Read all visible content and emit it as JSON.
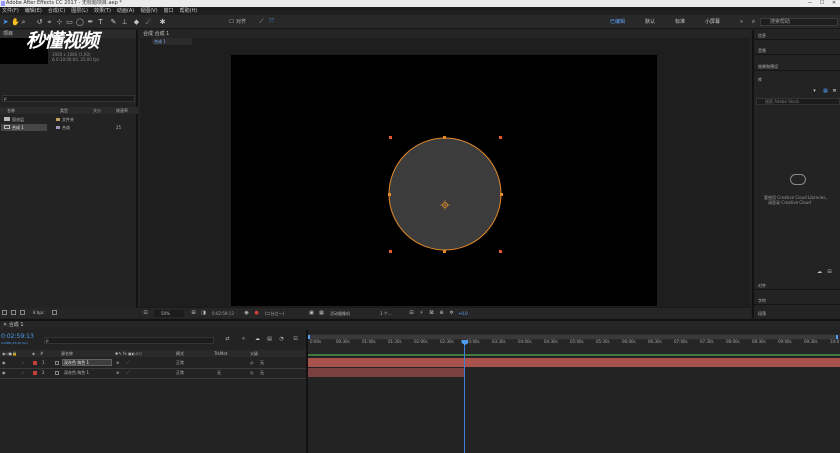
{
  "window": {
    "title": "Adobe After Effects CC 2017 - 无标题项目.aep *",
    "min": "—",
    "max": "☐",
    "close": "✕"
  },
  "menu": [
    "文件(F)",
    "编辑(E)",
    "合成(C)",
    "图层(L)",
    "效果(T)",
    "动画(A)",
    "视图(V)",
    "窗口",
    "帮助(H)"
  ],
  "toolbar": {
    "snap_label": "对齐",
    "workspaces": [
      "已编辑",
      "默认",
      "标准",
      "小屏幕"
    ],
    "search_placeholder": "搜索帮助",
    "more": "»"
  },
  "watermark": "秒懂视频",
  "project": {
    "tab": "项目",
    "comp_info": [
      "1920 x 1080 (1.00)",
      "Δ 0:10:00:00, 25.00 fps"
    ],
    "search_prefix": "ρ",
    "columns": [
      "名称",
      "类型",
      "大小",
      "帧速率"
    ],
    "rows": [
      {
        "name": "固态层",
        "type": "文件夹",
        "size": "",
        "fps": ""
      },
      {
        "name": "合成 1",
        "type": "合成",
        "size": "",
        "fps": "25"
      }
    ],
    "bpc": "8 bpc"
  },
  "composition": {
    "tab": "合成 合成 1",
    "breadcrumb": "合成 1",
    "zoom": "50%",
    "timecode": "0:02:59:13",
    "resolution": "(二分之一)",
    "camera": "活动摄像机",
    "views": "1 个...",
    "exposure": "+0.0"
  },
  "right_panels": {
    "top": [
      "信息",
      "音频",
      "效果和预设"
    ],
    "library": "库",
    "library_search": "搜索 Adobe Stock",
    "cc_message": [
      "要使用 Creative Cloud Libraries，",
      "请登录 Creative Cloud"
    ],
    "bottom": [
      "对齐",
      "字符",
      "段落"
    ]
  },
  "timeline": {
    "tab": "合成 1",
    "timecode": "0:02:59:13",
    "timecode_sub": "04488 (25.00 fps)",
    "search_prefix": "ρ",
    "columns": {
      "source": "源名称",
      "mode": "模式",
      "trkmat": "TrkMat",
      "parent": "父级"
    },
    "layers": [
      {
        "index": "1",
        "name": "深灰色 纯色 1",
        "mode": "正常",
        "trkmat": "",
        "parent": "无",
        "color": "#c04040"
      },
      {
        "index": "2",
        "name": "深灰色 纯色 1",
        "mode": "正常",
        "trkmat": "无",
        "parent": "无",
        "color": "#c04040"
      }
    ],
    "ruler": [
      "0:00s",
      "00:30s",
      "01:00s",
      "01:30s",
      "02:00s",
      "02:30s",
      "03:00s",
      "03:30s",
      "04:00s",
      "04:30s",
      "05:00s",
      "05:30s",
      "06:00s",
      "06:30s",
      "07:00s",
      "07:30s",
      "08:00s",
      "08:30s",
      "09:00s",
      "09:30s",
      "10:0"
    ],
    "playhead_fraction": 0.2998
  },
  "colors": {
    "accent": "#4d9cf2",
    "path": "#e38a2a",
    "layer_bar": "#a8524e",
    "layer_bar_lower": "#7a4040"
  }
}
